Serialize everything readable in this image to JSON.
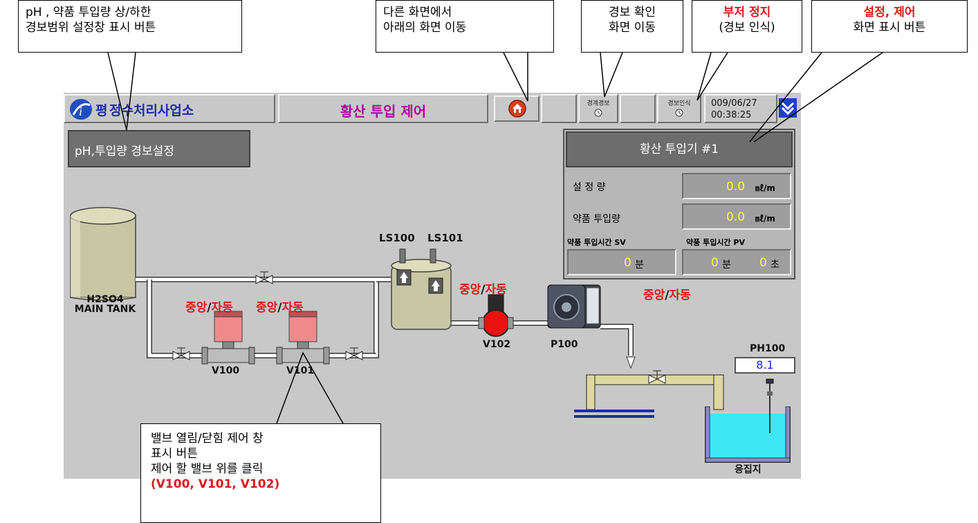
{
  "callouts": {
    "alarm_setting": {
      "line1": "pH , 약품 투입량 상/하한",
      "line2": "경보범위 설정창 표시 버튼"
    },
    "home": {
      "line1": "다른 화면에서",
      "line2": "아래의 화면 이동"
    },
    "alarm_check": {
      "line1": "경보 확인",
      "line2": "화면 이동"
    },
    "buzzer": {
      "line1": "부저 정지",
      "line2": "(경보 인식)"
    },
    "control": {
      "line1": "설정, 제어",
      "line2": "화면 표시 버튼"
    },
    "valve": {
      "line1": "밸브 열림/닫힘 제어 창",
      "line2": "표시 버튼",
      "line3": "제어 할 밸브 위를 클릭",
      "line4": "(V100, V101, V102)"
    }
  },
  "header": {
    "plant_name": "정수처리사업소",
    "plant_prefix": "평",
    "screen_title": "황산 투입 제어",
    "alarm_label": "경계경보",
    "ack_label": "경보인식",
    "date": "009/06/27",
    "time": "00:38:25"
  },
  "alarm_button": {
    "label": "pH,투입량 경보설정"
  },
  "panel": {
    "title": "황산 투입기 #1",
    "setpoint_label": "설   정   량",
    "setpoint_value": "0.0",
    "setpoint_unit": "㎖/m",
    "dose_label": "약품 투입량",
    "dose_value": "0.0",
    "dose_unit": "㎖/m",
    "sv_label": "약품 투입시간 SV",
    "pv_label": "약품 투입시간 PV",
    "sv_value": "0",
    "sv_unit": "분",
    "pv_min": "0",
    "pv_min_unit": "분",
    "pv_sec": "0",
    "pv_sec_unit": "초"
  },
  "mode": {
    "central": "중앙",
    "sep": "/",
    "auto": "자동"
  },
  "equipment": {
    "tank": "H2SO4\nMAIN TANK",
    "tank_line1": "H2SO4",
    "tank_line2": "MAIN TANK",
    "ls100": "LS100",
    "ls101": "LS101",
    "v100": "V100",
    "v101": "V101",
    "v102": "V102",
    "p100": "P100",
    "ph_tag": "PH100",
    "ph_value": "8.1",
    "basin": "응집지"
  },
  "colors": {
    "accent_red": "#e0151b",
    "title_magenta": "#b0009e",
    "value_yellow": "#ffff3a",
    "ph_blue": "#1a1aff",
    "water_cyan": "#3ee6f4"
  }
}
